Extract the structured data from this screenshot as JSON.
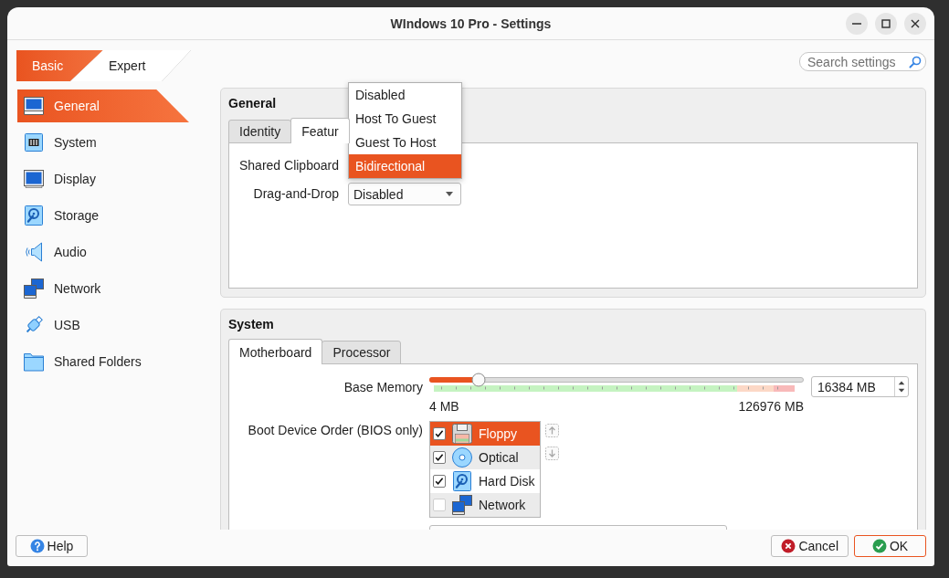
{
  "window": {
    "title": "WIndows 10 Pro - Settings"
  },
  "mode_tabs": [
    {
      "label": "Basic",
      "selected": true
    },
    {
      "label": "Expert",
      "selected": false
    }
  ],
  "search": {
    "placeholder": "Search settings"
  },
  "sidebar": {
    "items": [
      {
        "label": "General",
        "kind": "general",
        "selected": true
      },
      {
        "label": "System",
        "kind": "system",
        "selected": false
      },
      {
        "label": "Display",
        "kind": "display",
        "selected": false
      },
      {
        "label": "Storage",
        "kind": "storage",
        "selected": false
      },
      {
        "label": "Audio",
        "kind": "audio",
        "selected": false
      },
      {
        "label": "Network",
        "kind": "network",
        "selected": false
      },
      {
        "label": "USB",
        "kind": "usb",
        "selected": false
      },
      {
        "label": "Shared Folders",
        "kind": "folders",
        "selected": false
      }
    ]
  },
  "general": {
    "title": "General",
    "tabs": [
      {
        "label": "Identity",
        "selected": false
      },
      {
        "label": "Featur",
        "selected": true
      }
    ],
    "shared_clipboard": {
      "label": "Shared Clipboard",
      "expanded": true,
      "options": [
        {
          "label": "Disabled",
          "selected": false
        },
        {
          "label": "Host To Guest",
          "selected": false
        },
        {
          "label": "Guest To Host",
          "selected": false
        },
        {
          "label": "Bidirectional",
          "selected": true
        }
      ]
    },
    "drag_and_drop": {
      "label": "Drag-and-Drop",
      "value": "Disabled"
    }
  },
  "system": {
    "title": "System",
    "tabs": [
      {
        "label": "Motherboard",
        "selected": true
      },
      {
        "label": "Processor",
        "selected": false
      }
    ],
    "base_memory": {
      "label": "Base Memory",
      "level": 0.13,
      "min": "4 MB",
      "max": "126976 MB",
      "value": "16384 MB"
    },
    "boot_order": {
      "label": "Boot Device Order (BIOS only)",
      "devices": [
        {
          "label": "Floppy",
          "kind": "floppy",
          "checked": true,
          "selected": true
        },
        {
          "label": "Optical",
          "kind": "optical",
          "checked": true,
          "selected": false
        },
        {
          "label": "Hard Disk",
          "kind": "harddisk",
          "checked": true,
          "selected": false
        },
        {
          "label": "Network",
          "kind": "network",
          "checked": false,
          "selected": false
        }
      ]
    }
  },
  "buttons": [
    {
      "label": "Help",
      "kind": "help",
      "default": false
    },
    {
      "label": "Cancel",
      "kind": "cancel",
      "default": false
    },
    {
      "label": "OK",
      "kind": "ok",
      "default": true
    }
  ]
}
